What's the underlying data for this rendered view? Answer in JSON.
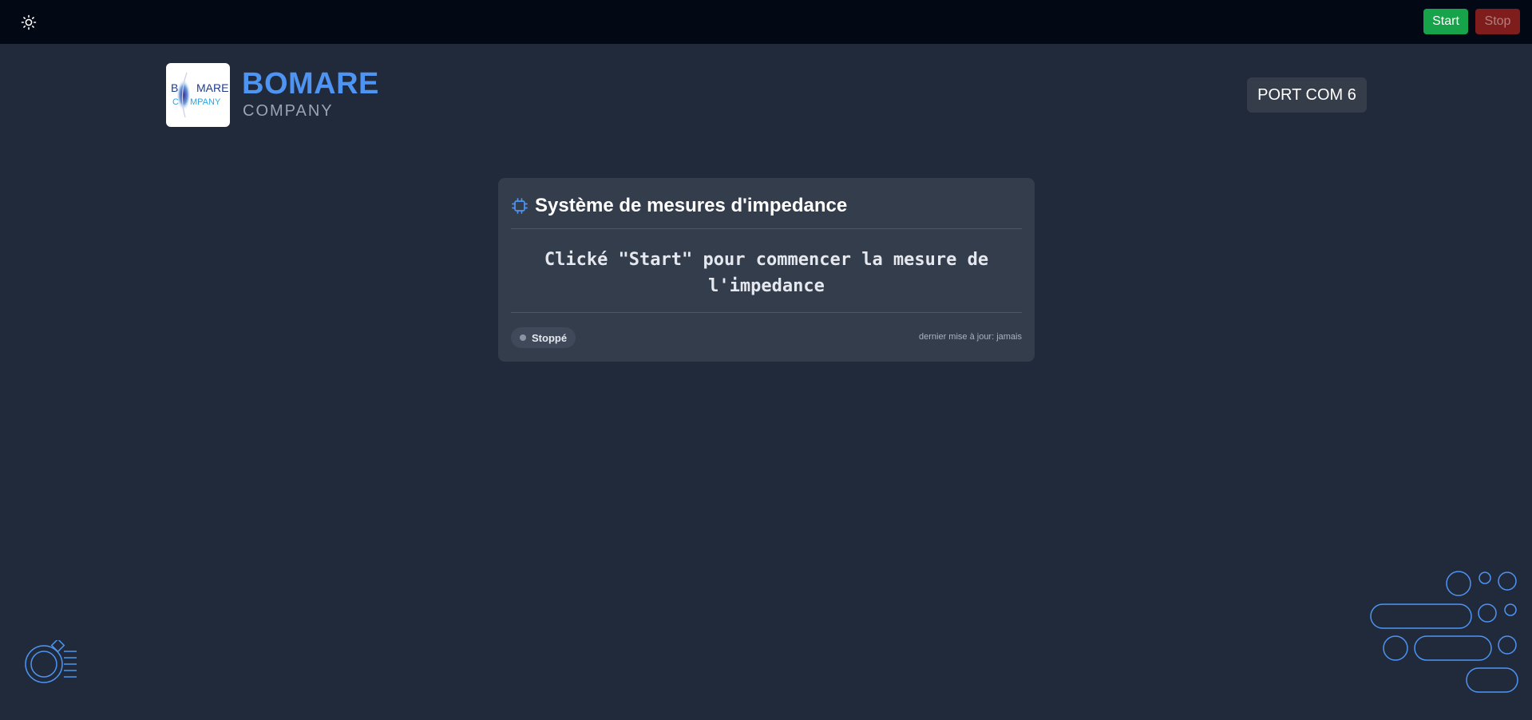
{
  "topbar": {
    "theme_toggle_icon": "sun-icon",
    "start_label": "Start",
    "stop_label": "Stop",
    "start_color": "#16a34a",
    "stop_color": "#7f1d1d"
  },
  "brand": {
    "logo_text_line1_left": "B",
    "logo_text_line1_right": "MARE",
    "logo_text_line2_left": "C",
    "logo_text_line2_right": "MPANY",
    "name": "BOMARE",
    "subtitle": "COMPANY",
    "accent_color": "#4d94f3"
  },
  "port": {
    "label": "PORT COM 6"
  },
  "card": {
    "icon": "chip-icon",
    "title": "Système de mesures d'impedance",
    "message": "Clické \"Start\" pour commencer la mesure de l'impedance",
    "status": "Stoppé",
    "last_update": "dernier mise à jour: jamais"
  },
  "decorations": {
    "bottom_left_icon": "ring-diamond-icon",
    "bottom_right_icon": "bubbles-pattern-icon"
  }
}
